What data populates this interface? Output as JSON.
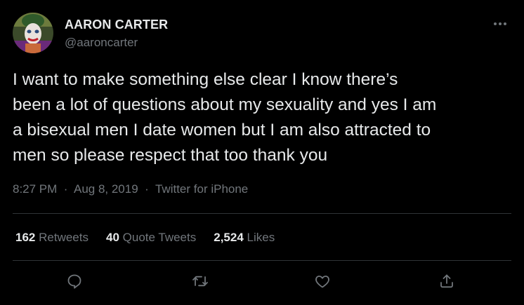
{
  "author": {
    "display_name": "AARON CARTER",
    "handle": "@aaroncarter",
    "avatar_icon": "joker-face-avatar"
  },
  "tweet": {
    "text": "I want to make something else clear I know there’s\nbeen a lot of questions about my sexuality and yes I am\na bisexual men I date women but I am also attracted to\nmen so please respect that too thank you",
    "time": "8:27 PM",
    "date": "Aug 8, 2019",
    "source": "Twitter for iPhone",
    "separator": "·"
  },
  "stats": {
    "retweets": {
      "count": "162",
      "label": "Retweets"
    },
    "quotes": {
      "count": "40",
      "label": "Quote Tweets"
    },
    "likes": {
      "count": "2,524",
      "label": "Likes"
    }
  },
  "actions": [
    "reply-icon",
    "retweet-icon",
    "like-icon",
    "share-icon"
  ],
  "colors": {
    "background": "#000000",
    "primary_text": "#e7e9ea",
    "secondary_text": "#71767b",
    "divider": "#2f3336"
  }
}
